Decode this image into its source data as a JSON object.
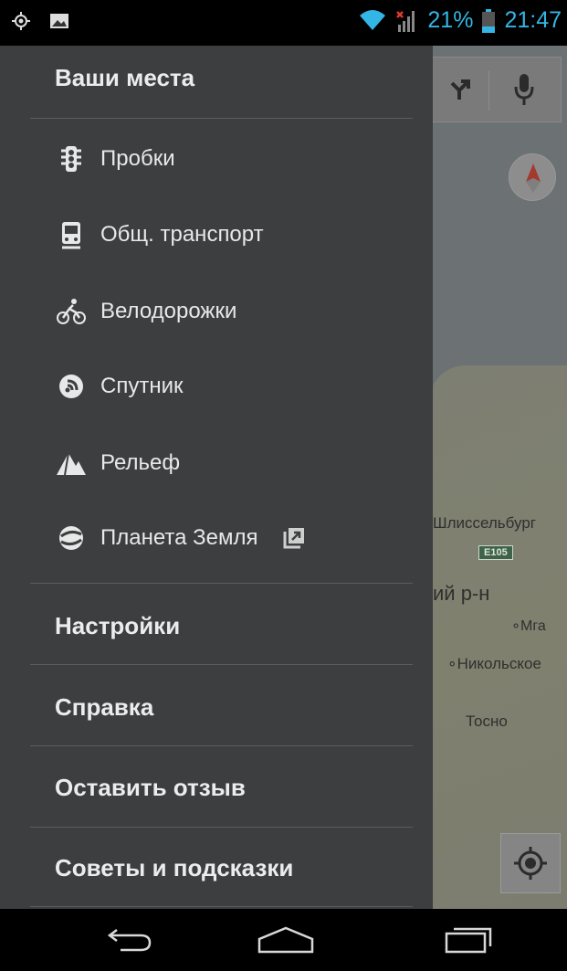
{
  "status_bar": {
    "battery_percent": "21%",
    "time": "21:47",
    "icons": [
      "location-icon",
      "image-notification-icon",
      "wifi-icon",
      "signal-no-data-icon",
      "battery-icon"
    ],
    "accent_color": "#33b5e5"
  },
  "drawer": {
    "header": "Ваши места",
    "layers": [
      {
        "label": "Пробки",
        "icon": "traffic-light-icon"
      },
      {
        "label": "Общ. транспорт",
        "icon": "train-icon"
      },
      {
        "label": "Велодорожки",
        "icon": "bicycle-icon"
      },
      {
        "label": "Спутник",
        "icon": "satellite-icon"
      },
      {
        "label": "Рельеф",
        "icon": "terrain-icon"
      },
      {
        "label": "Планета Земля",
        "icon": "earth-icon",
        "external": true
      }
    ],
    "settings": "Настройки",
    "help": "Справка",
    "feedback": "Оставить отзыв",
    "tips": "Советы и подсказки"
  },
  "map": {
    "labels": {
      "shlisselburg": "Шлиссельбург",
      "road": "E105",
      "district": "ий р-н",
      "mga": "Мга",
      "nikolskoe": "Никольское",
      "tosno": "Тосно"
    }
  }
}
